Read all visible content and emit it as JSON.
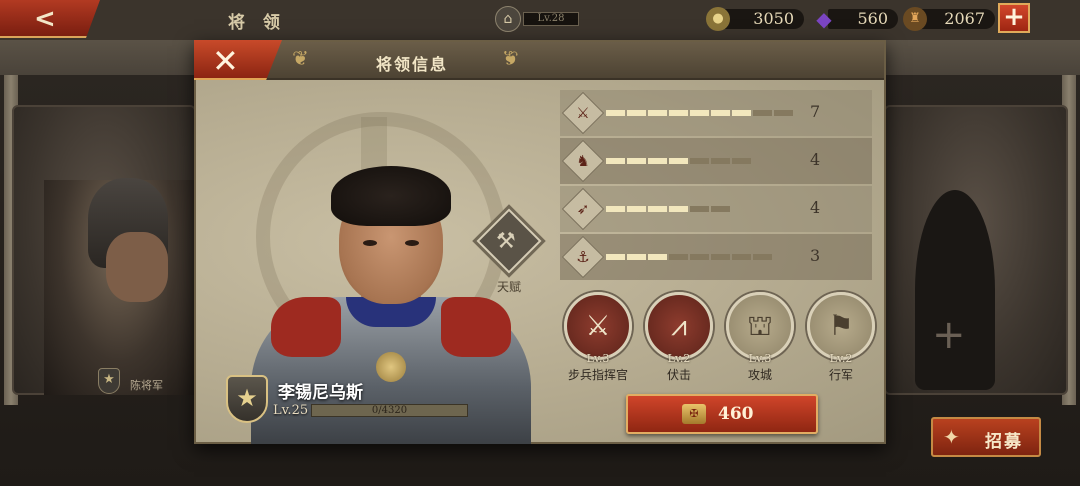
{
  "topbar": {
    "title": "将 领",
    "player_level": "Lv.28",
    "resources": [
      {
        "name": "gold",
        "icon": "coin-icon",
        "value": "3050",
        "color": "#c9a649"
      },
      {
        "name": "gem",
        "icon": "gem-icon",
        "value": "560",
        "color": "#6a3aa8"
      },
      {
        "name": "food",
        "icon": "helmet-icon",
        "value": "2067",
        "color": "#c98a3a"
      }
    ]
  },
  "background": {
    "left_card_label": "陈将军",
    "recruit_label": "招募"
  },
  "modal": {
    "title": "将领信息",
    "hero": {
      "name": "李锡尼乌斯",
      "level": "Lv.25",
      "xp_text": "0/4320",
      "xp_progress": 0
    },
    "talent_label": "天赋",
    "stats": [
      {
        "icon": "sword-icon",
        "glyph": "⚔",
        "value": "7",
        "filled": 7,
        "total": 9
      },
      {
        "icon": "horse-icon",
        "glyph": "♞",
        "value": "4",
        "filled": 4,
        "total": 7
      },
      {
        "icon": "bow-icon",
        "glyph": "➶",
        "value": "4",
        "filled": 4,
        "total": 6
      },
      {
        "icon": "anchor-icon",
        "glyph": "⚓",
        "value": "3",
        "filled": 3,
        "total": 8
      }
    ],
    "skills": [
      {
        "level": "Lv.3",
        "name": "步兵指挥官",
        "glyph": "⚔",
        "style": "red"
      },
      {
        "level": "Lv.2",
        "name": "伏击",
        "glyph": "⩘",
        "style": "red"
      },
      {
        "level": "Lv.3",
        "name": "攻城",
        "glyph": "⛫",
        "style": "pale"
      },
      {
        "level": "Lv.2",
        "name": "行军",
        "glyph": "⚑",
        "style": "pale"
      }
    ],
    "cost": "460"
  },
  "colors": {
    "accent_red": "#c0432a",
    "gold_border": "#e2ad63",
    "parchment": "#c9bfa4"
  }
}
